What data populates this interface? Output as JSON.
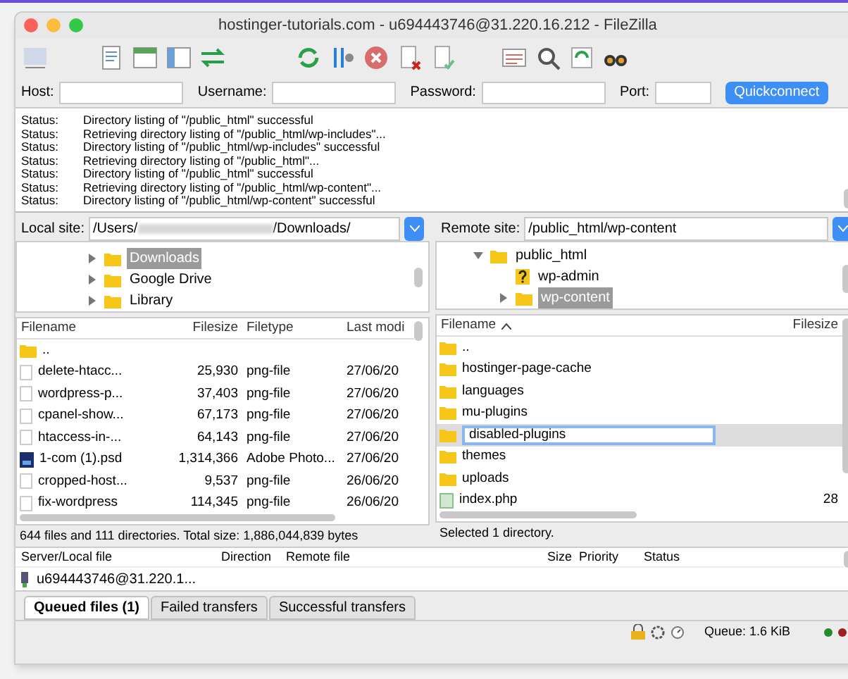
{
  "window": {
    "title": "hostinger-tutorials.com - u694443746@31.220.16.212 - FileZilla"
  },
  "quickconnect": {
    "fields": [
      {
        "label": "Host:"
      },
      {
        "label": "Username:"
      },
      {
        "label": "Password:"
      },
      {
        "label": "Port:"
      }
    ],
    "button": "Quickconnect"
  },
  "log": [
    {
      "label": "Status:",
      "message": "Directory listing of \"/public_html\" successful"
    },
    {
      "label": "Status:",
      "message": "Retrieving directory listing of \"/public_html/wp-includes\"..."
    },
    {
      "label": "Status:",
      "message": "Directory listing of \"/public_html/wp-includes\" successful"
    },
    {
      "label": "Status:",
      "message": "Retrieving directory listing of \"/public_html\"..."
    },
    {
      "label": "Status:",
      "message": "Directory listing of \"/public_html\" successful"
    },
    {
      "label": "Status:",
      "message": "Retrieving directory listing of \"/public_html/wp-content\"..."
    },
    {
      "label": "Status:",
      "message": "Directory listing of \"/public_html/wp-content\" successful"
    }
  ],
  "local": {
    "site_label": "Local site:",
    "path_start": "/Users/",
    "path_end": "/Downloads/",
    "tree": [
      {
        "name": "Downloads",
        "kind": "folder",
        "expanded": false,
        "selected": true
      },
      {
        "name": "Google Drive",
        "kind": "folder",
        "expanded": false,
        "selected": false
      },
      {
        "name": "Library",
        "kind": "folder",
        "expanded": false,
        "selected": false
      }
    ],
    "columns": [
      "Filename",
      "Filesize",
      "Filetype",
      "Last modi"
    ],
    "rows": [
      {
        "kind": "folder",
        "name": ".."
      },
      {
        "kind": "file",
        "name": "delete-htacc...",
        "size": "25,930",
        "type": "png-file",
        "date": "27/06/20"
      },
      {
        "kind": "file",
        "name": "wordpress-p...",
        "size": "37,403",
        "type": "png-file",
        "date": "27/06/20"
      },
      {
        "kind": "file",
        "name": "cpanel-show...",
        "size": "67,173",
        "type": "png-file",
        "date": "27/06/20"
      },
      {
        "kind": "file",
        "name": "htaccess-in-...",
        "size": "64,143",
        "type": "png-file",
        "date": "27/06/20"
      },
      {
        "kind": "psd",
        "name": "1-com (1).psd",
        "size": "1,314,366",
        "type": "Adobe Photo...",
        "date": "27/06/20"
      },
      {
        "kind": "file",
        "name": "cropped-host...",
        "size": "9,537",
        "type": "png-file",
        "date": "26/06/20"
      },
      {
        "kind": "file",
        "name": "fix-wordpress",
        "size": "114,345",
        "type": "png-file",
        "date": "26/06/20"
      }
    ],
    "status": "644 files and 111 directories. Total size: 1,886,044,839 bytes"
  },
  "remote": {
    "site_label": "Remote site:",
    "path": "/public_html/wp-content",
    "tree": [
      {
        "name": "public_html",
        "kind": "folder",
        "expanded": true,
        "selected": false,
        "children": [
          {
            "name": "wp-admin",
            "kind": "unknown",
            "selected": false
          },
          {
            "name": "wp-content",
            "kind": "folder",
            "expanded": false,
            "selected": true
          }
        ]
      }
    ],
    "columns": [
      "Filename",
      "Filesize"
    ],
    "rows": [
      {
        "kind": "folder",
        "name": "..",
        "selected": false,
        "editing": false
      },
      {
        "kind": "folder",
        "name": "hostinger-page-cache",
        "selected": false,
        "editing": false
      },
      {
        "kind": "folder",
        "name": "languages",
        "selected": false,
        "editing": false
      },
      {
        "kind": "folder",
        "name": "mu-plugins",
        "selected": false,
        "editing": false
      },
      {
        "kind": "folder",
        "name": "disabled-plugins",
        "selected": true,
        "editing": true
      },
      {
        "kind": "folder",
        "name": "themes",
        "selected": false,
        "editing": false
      },
      {
        "kind": "folder",
        "name": "uploads",
        "selected": false,
        "editing": false
      },
      {
        "kind": "php",
        "name": "index.php",
        "size": "28",
        "selected": false,
        "editing": false
      }
    ],
    "status": "Selected 1 directory."
  },
  "queue": {
    "columns": [
      "Server/Local file",
      "Direction",
      "Remote file",
      "Size",
      "Priority",
      "Status"
    ],
    "rows": [
      {
        "server": "u694443746@31.220.1..."
      }
    ],
    "tabs": [
      {
        "label": "Queued files (1)",
        "selected": true
      },
      {
        "label": "Failed transfers",
        "selected": false
      },
      {
        "label": "Successful transfers",
        "selected": false
      }
    ]
  },
  "status_bar": {
    "queue": "Queue: 1.6 KiB"
  }
}
